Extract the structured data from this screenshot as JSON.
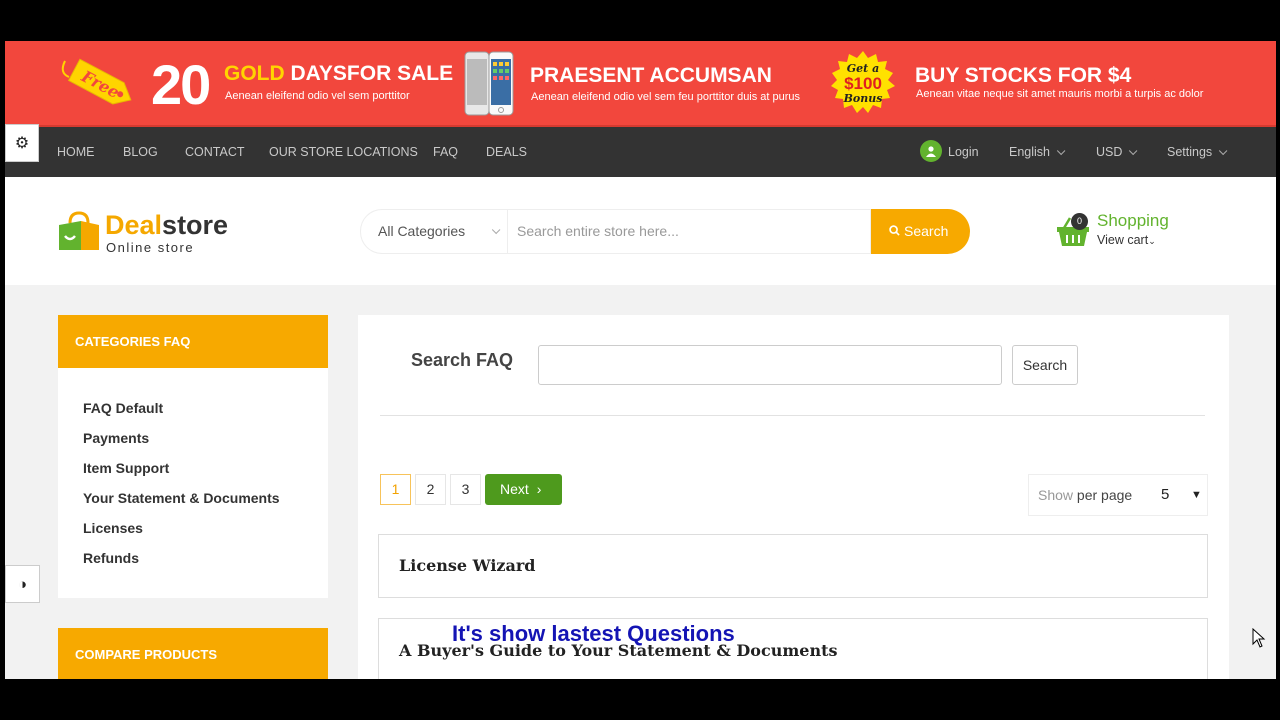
{
  "banner": {
    "promo1": {
      "number": "20",
      "title_gold": "GOLD",
      "title_rest": " DAYSFOR SALE",
      "sub": "Aenean eleifend odio vel sem porttitor",
      "tag_text": "Free"
    },
    "promo2": {
      "title": "PRAESENT ACCUMSAN",
      "sub": "Aenean eleifend odio vel sem feu porttitor duis at purus"
    },
    "promo3": {
      "badge_line1": "Get a",
      "badge_line2": "$100",
      "badge_line3": "Bonus",
      "title": "BUY STOCKS FOR $4",
      "sub": "Aenean vitae neque sit amet mauris morbi a turpis ac dolor"
    },
    "bg_color": "#f2473d"
  },
  "nav": {
    "items": [
      "HOME",
      "BLOG",
      "CONTACT",
      "OUR STORE LOCATIONS",
      "FAQ",
      "DEALS"
    ],
    "login": "Login",
    "language": "English",
    "currency": "USD",
    "settings": "Settings"
  },
  "header": {
    "logo_deal": "Deal",
    "logo_store": "store",
    "logo_sub": "Online store",
    "category_select": "All Categories",
    "search_placeholder": "Search entire store here...",
    "search_button": "Search",
    "cart_count": "0",
    "cart_title": "Shopping",
    "cart_sub": "View cart"
  },
  "sidebar": {
    "categories_title": "CATEGORIES FAQ",
    "items": [
      "FAQ Default",
      "Payments",
      "Item Support",
      "Your Statement & Documents",
      "Licenses",
      "Refunds"
    ],
    "compare_title": "COMPARE PRODUCTS"
  },
  "main": {
    "search_label": "Search FAQ",
    "search_button": "Search",
    "pages": [
      "1",
      "2",
      "3"
    ],
    "active_page": "1",
    "next_label": "Next",
    "per_page_show": "Show",
    "per_page_text": " per page",
    "per_page_value": "5",
    "faq_items": [
      "License Wizard",
      "A Buyer's Guide to Your Statement & Documents"
    ]
  },
  "caption": "It's show lastest Questions",
  "colors": {
    "accent": "#f7a900",
    "green": "#4e9a1d",
    "nav_bg": "#333333"
  }
}
